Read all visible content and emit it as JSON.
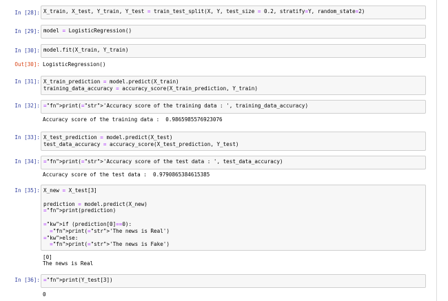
{
  "cells": [
    {
      "prompt": "In [28]:",
      "code": [
        "X_train, X_test, Y_train, Y_test = train_test_split(X, Y, test_size = 0.2, stratify=Y, random_state=2)"
      ]
    },
    {
      "prompt": "In [29]:",
      "code": [
        "model = LogisticRegression()"
      ]
    },
    {
      "prompt": "In [30]:",
      "code": [
        "model.fit(X_train, Y_train)"
      ],
      "out_prompt": "Out[30]:",
      "output": [
        "LogisticRegression()"
      ]
    },
    {
      "prompt": "In [31]:",
      "code": [
        "X_train_prediction = model.predict(X_train)",
        "training_data_accuracy = accuracy_score(X_train_prediction, Y_train)"
      ]
    },
    {
      "prompt": "In [32]:",
      "code": [
        "print('Accuracy score of the training data : ', training_data_accuracy)"
      ],
      "output": [
        "Accuracy score of the training data :  0.9865985576923076"
      ]
    },
    {
      "prompt": "In [33]:",
      "code": [
        "X_test_prediction = model.predict(X_test)",
        "test_data_accuracy = accuracy_score(X_test_prediction, Y_test)"
      ]
    },
    {
      "prompt": "In [34]:",
      "code": [
        "print('Accuracy score of the test data : ', test_data_accuracy)"
      ],
      "output": [
        "Accuracy score of the test data :  0.9790865384615385"
      ]
    },
    {
      "prompt": "In [35]:",
      "code": [
        "X_new = X_test[3]",
        "",
        "prediction = model.predict(X_new)",
        "print(prediction)",
        "",
        "if (prediction[0]==0):",
        "  print('The news is Real')",
        "else:",
        "  print('The news is Fake')"
      ],
      "output": [
        "[0]",
        "The news is Real"
      ]
    },
    {
      "prompt": "In [36]:",
      "code": [
        "print(Y_test[3])"
      ],
      "output": [
        "0"
      ]
    }
  ]
}
